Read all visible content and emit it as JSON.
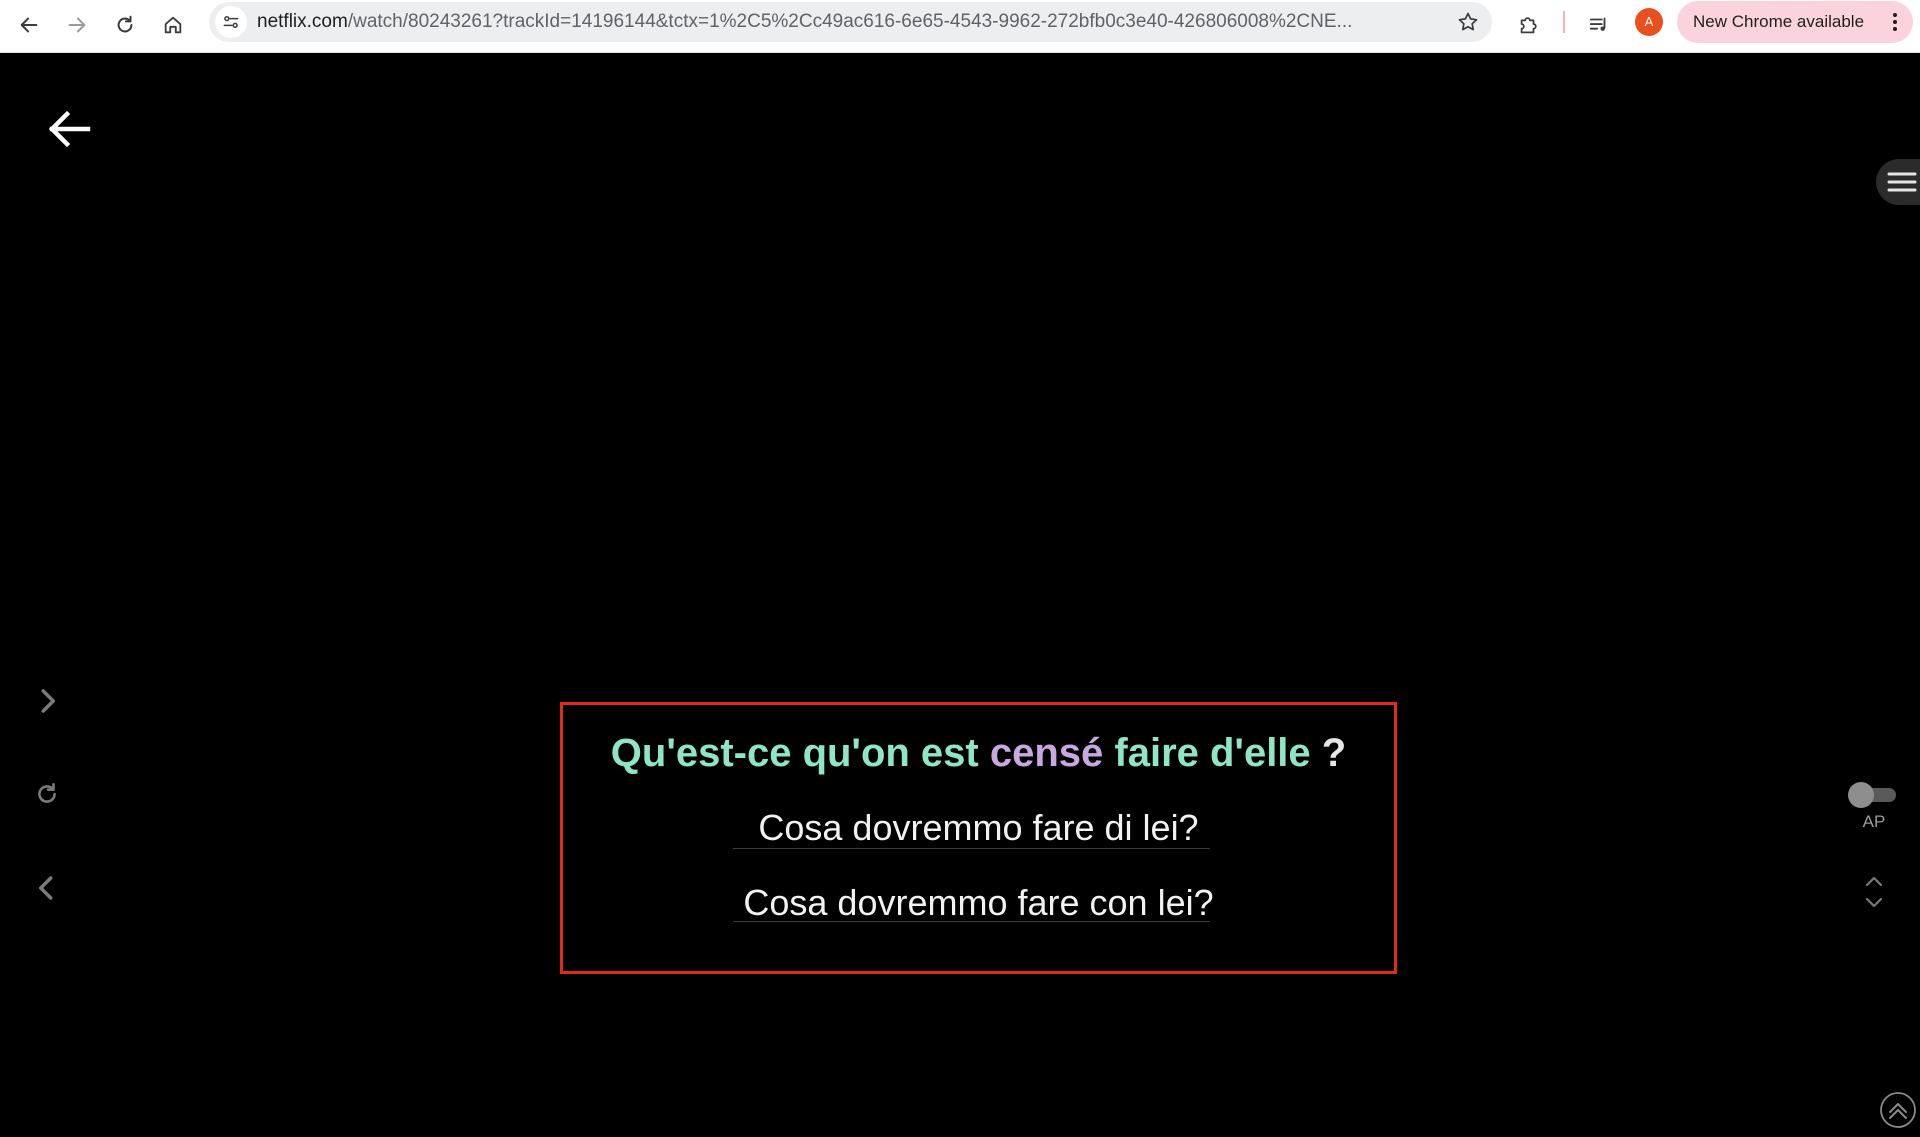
{
  "browser": {
    "nav": {
      "back_icon": "arrow-left-icon",
      "forward_icon": "arrow-right-icon",
      "reload_icon": "reload-icon",
      "home_icon": "home-icon"
    },
    "address_bar": {
      "domain": "netflix.com",
      "path": "/watch/80243261?trackId=14196144&tctx=1%2C5%2Cc49ac616-6e65-4543-9962-272bfb0c3e40-426806008%2CNE...",
      "site_info_icon": "tune-icon",
      "bookmark_icon": "star-icon"
    },
    "extensions_icon": "puzzle-icon",
    "media_icon": "media-queue-icon",
    "profile_initial": "A",
    "update_chip": {
      "label": "New Chrome available",
      "menu_icon": "kebab-icon"
    },
    "colors": {
      "toolbar_bg": "#ffffff",
      "omnibox_bg": "#edeef0",
      "chip_bg": "#fbd3dc",
      "avatar_bg": "#e8501f"
    }
  },
  "player": {
    "back_icon": "back-arrow-icon",
    "side_menu_icon": "hamburger-icon",
    "left_controls": {
      "next_icon": "chevron-right-icon",
      "repeat_icon": "repeat-icon",
      "previous_icon": "chevron-left-icon"
    },
    "subtitles": {
      "original_parts": {
        "before": "Qu'est-ce qu'on est ",
        "highlight": "censé",
        "after": " faire d'elle",
        "punct": " ?"
      },
      "translation_1": "Cosa dovremmo fare di lei?",
      "translation_2": "Cosa dovremmo fare con lei?"
    },
    "right_controls": {
      "autopause_label": "AP",
      "autopause_on": false,
      "updown_icon": "chevron-up-down-icon",
      "scroll_top_icon": "scroll-to-top-icon"
    },
    "colors": {
      "background": "#000000",
      "highlight_box": "#e02a20",
      "original_text": "#8ee6c4",
      "highlight_word": "#c9a8e2",
      "translation_text": "#f2f2f2"
    }
  }
}
